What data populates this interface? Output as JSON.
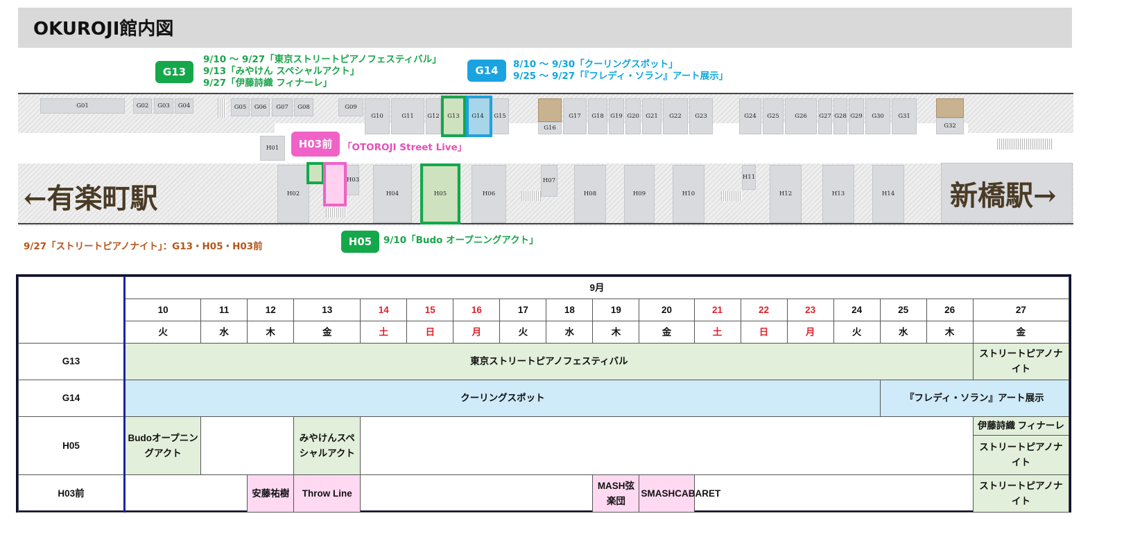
{
  "title": "OKUROJI館内図",
  "colors": {
    "green": "#14a84a",
    "blue": "#1aa3e0",
    "pink": "#f062c8",
    "brown": "#b5561a"
  },
  "badges": {
    "g13": "G13",
    "g14": "G14",
    "h03": "H03前",
    "h05": "H05"
  },
  "annotations": {
    "g13": [
      "9/10 ～ 9/27「東京ストリートピアノフェスティバル」",
      "9/13「みやけん スペシャルアクト」",
      "9/27「伊藤詩織 フィナーレ」"
    ],
    "g14": [
      "8/10 ～ 9/30「クーリングスポット」",
      "9/25 ～ 9/27「『フレディ・ソラン』アート展示」"
    ],
    "h03": "「OTOROJI Street Live」",
    "h05": "9/10「Budo オープニングアクト」",
    "night": "9/27「ストリートピアノナイト」：G13・H05・H03前"
  },
  "map": {
    "station_left": "←有楽町駅",
    "station_right": "新橋駅→",
    "g_units": [
      "G01",
      "G02",
      "G03",
      "G04",
      "G05",
      "G06",
      "G07",
      "G08",
      "G09",
      "G10",
      "G11",
      "G12",
      "G13",
      "G14",
      "G15",
      "G16",
      "G17",
      "G18",
      "G19",
      "G20",
      "G21",
      "G22",
      "G23",
      "G24",
      "G25",
      "G26",
      "G27",
      "G28",
      "G29",
      "G30",
      "G31",
      "G32"
    ],
    "h_units": [
      "H01",
      "H02",
      "H03",
      "H04",
      "H05",
      "H06",
      "H07",
      "H08",
      "H09",
      "H10",
      "H11",
      "H12",
      "H13",
      "H14"
    ]
  },
  "schedule": {
    "month": "9月",
    "days": [
      "10",
      "11",
      "12",
      "13",
      "14",
      "15",
      "16",
      "17",
      "18",
      "19",
      "20",
      "21",
      "22",
      "23",
      "24",
      "25",
      "26",
      "27"
    ],
    "weekdays": [
      "火",
      "水",
      "木",
      "金",
      "土",
      "日",
      "月",
      "火",
      "水",
      "木",
      "金",
      "土",
      "日",
      "月",
      "火",
      "水",
      "木",
      "金"
    ],
    "rows": {
      "g13": {
        "label": "G13",
        "main": "東京ストリートピアノフェスティバル",
        "last": "ストリートピアノナイト"
      },
      "g14": {
        "label": "G14",
        "main": "クーリングスポット",
        "last": "『フレディ・ソラン』アート展示"
      },
      "h05": {
        "label": "H05",
        "budo": "Budoオープニングアクト",
        "miyaken": "みやけんスペシャルアクト",
        "ito": "伊藤詩織 フィナーレ",
        "night": "ストリートピアノナイト"
      },
      "h03": {
        "label": "H03前",
        "ando": "安藤祐樹",
        "throw": "Throw Line",
        "mash": "MASH弦楽団",
        "smash": "SMASHCABARET",
        "night": "ストリートピアノナイト"
      }
    }
  }
}
